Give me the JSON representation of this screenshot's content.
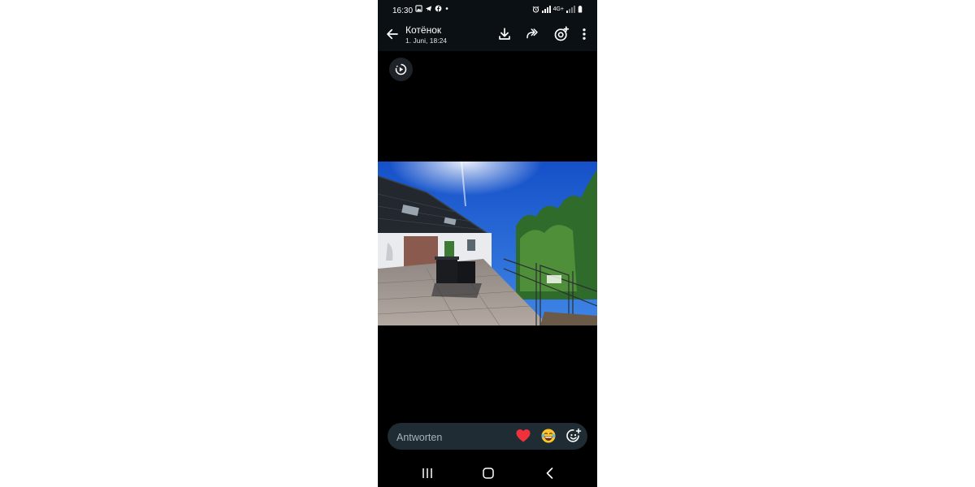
{
  "status_bar": {
    "time": "16:30",
    "network_label": "4G+"
  },
  "header": {
    "title": "Котёнок",
    "subtitle": "1. Juni, 18:24"
  },
  "reply": {
    "placeholder": "Antworten"
  }
}
